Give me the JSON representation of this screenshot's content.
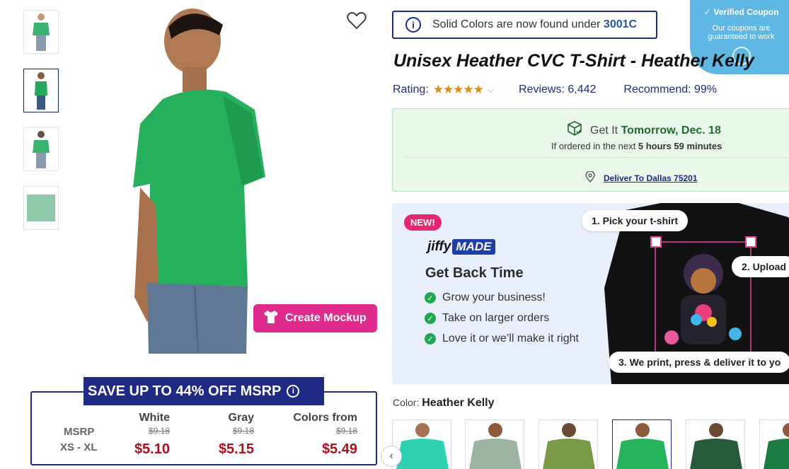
{
  "gallery": {
    "thumbs": [
      {
        "icon": "shirt-front-thumb"
      },
      {
        "icon": "shirt-side-thumb"
      },
      {
        "icon": "shirt-back-thumb"
      },
      {
        "icon": "fabric-swatch-thumb"
      }
    ],
    "mockup_label": "Create Mockup"
  },
  "savings": {
    "banner": "SAVE UP TO 44% OFF MSRP",
    "msrp_label": "MSRP",
    "size_label": "XS - XL",
    "columns": [
      {
        "name": "White",
        "msrp": "$9.18",
        "price": "$5.10"
      },
      {
        "name": "Gray",
        "msrp": "$9.18",
        "price": "$5.15"
      },
      {
        "name": "Colors from",
        "msrp": "$9.18",
        "price": "$5.49"
      }
    ]
  },
  "notice": {
    "text": "Solid Colors are now found under ",
    "link": "3001C"
  },
  "coupon": {
    "title": "Verified Coupon",
    "line1": "Our coupons are",
    "line2": "guaranteed to work"
  },
  "product": {
    "title": "Unisex Heather CVC T-Shirt - Heather Kelly",
    "rating_label": "Rating:",
    "stars": "★★★★★",
    "reviews": "Reviews: 6,442",
    "recommend": "Recommend:  99%"
  },
  "delivery": {
    "get_it": "Get It ",
    "date": "Tomorrow, Dec. 18",
    "ordered_prefix": "If ordered in the next ",
    "countdown": "5 hours 59 minutes",
    "deliver_to": "Deliver To Dallas 75201"
  },
  "promo": {
    "badge": "NEW!",
    "brand_a": "jiffy",
    "brand_b": "MADE",
    "headline": "Get Back Time",
    "bullets": [
      "Grow your business!",
      "Take on larger orders",
      "Love it or we’ll make it right"
    ],
    "step1": "1. Pick your t-shirt",
    "step2": "2. Upload",
    "step3": "3. We print, press & deliver it to yo"
  },
  "color": {
    "label": "Color: ",
    "value": "Heather Kelly"
  },
  "colors": {
    "brand_green": "#2bb56a",
    "navy": "#1f2a85",
    "price_red": "#b0101c",
    "pink": "#df2b8c"
  }
}
